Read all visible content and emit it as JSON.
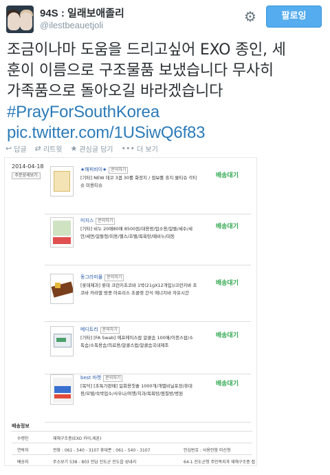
{
  "user": {
    "name": "94S : 일래보애졸리",
    "handle": "@ilestbeauetjoli",
    "follow_label": "팔로잉"
  },
  "tweet": {
    "lines": [
      "조금이나마 도움을 드리고싶어 EXO 종인, 세",
      "훈이 이름으로 구조물품 보냈습니다 무사히",
      "가족품으로 돌아오길 바라겠습니다"
    ],
    "hashtag": "#PrayForSouthKorea",
    "link": "pic.twitter.com/1USiwQ6f83"
  },
  "actions": {
    "reply": "답글",
    "retweet": "리트윗",
    "favorite": "관심글 담기",
    "more": "더 보기"
  },
  "icons": {
    "gear": "gear-icon",
    "reply": "reply-icon",
    "retweet": "retweet-icon",
    "favorite": "star-icon",
    "more": "more-dots-icon"
  },
  "colors": {
    "accent": "#55acee",
    "link": "#2b7bb9",
    "status_green": "#2fa84f",
    "muted": "#8899a6"
  },
  "media": {
    "date": "2014-04-18",
    "order_btn": "주문상세보기",
    "items": [
      {
        "seller": "★해피비이★",
        "question": "문의하기",
        "desc": "[기타] NEW 데코 3겹 30롤 화장지 / 점보롤 휴지 물티슈 각티슈 미용티슈",
        "status": "배송대기"
      },
      {
        "seller": "미지스",
        "question": "문의하기",
        "desc": "[기타] 비누 20매80매 8500원/대용량/업소용/알뜰/세수/세안/세면/알뜰형/미용/헬스/호텔/목욕탕/때비누/대동",
        "status": "배송대기"
      },
      {
        "seller": "동그라미몰",
        "question": "문의하기",
        "desc": "[롯데제과] 롯데 크런키초코바 1박(21gX12개입)/크런키바 초코바 카라멜 땅콩 아프리스 초콜렛 간식 에너지바 자유시간",
        "status": "배송대기"
      },
      {
        "seller": "메디트리",
        "question": "문의하기",
        "desc": "[기타] [FA Swab] 에프에이스왑 알콜솜 100매/이종스왑/소독솜/소독용솜/의료용/알콜스왑/알콜솜국내제조",
        "status": "배송대기"
      },
      {
        "seller": "best 마켓",
        "question": "문의하기",
        "desc": "[복덕] [초특가판매] 일회용칫솔 1000개/개별비닐포장/휴대용/모텔/숙박업소/사우나/여행/치과/목욕탕/찜질방/병원",
        "status": "배송대기"
      }
    ],
    "shipping": {
      "title": "배송정보",
      "rows": [
        {
          "label": "수령인",
          "value": "재해구조종(EXO 카이,세훈)",
          "extra": ""
        },
        {
          "label": "연락처",
          "value": "전화 : 061 - 540 - 3107   휴대폰 : 061 - 540 - 3107",
          "extra": "안심번호 : 사용안함 미신청"
        },
        {
          "label": "배송지",
          "value": "주소보기  538 - 803  전남 진도군 진도읍 성내리",
          "extra": "64-1 진도군청 주민복지과 재해구조종 접"
        }
      ]
    }
  }
}
